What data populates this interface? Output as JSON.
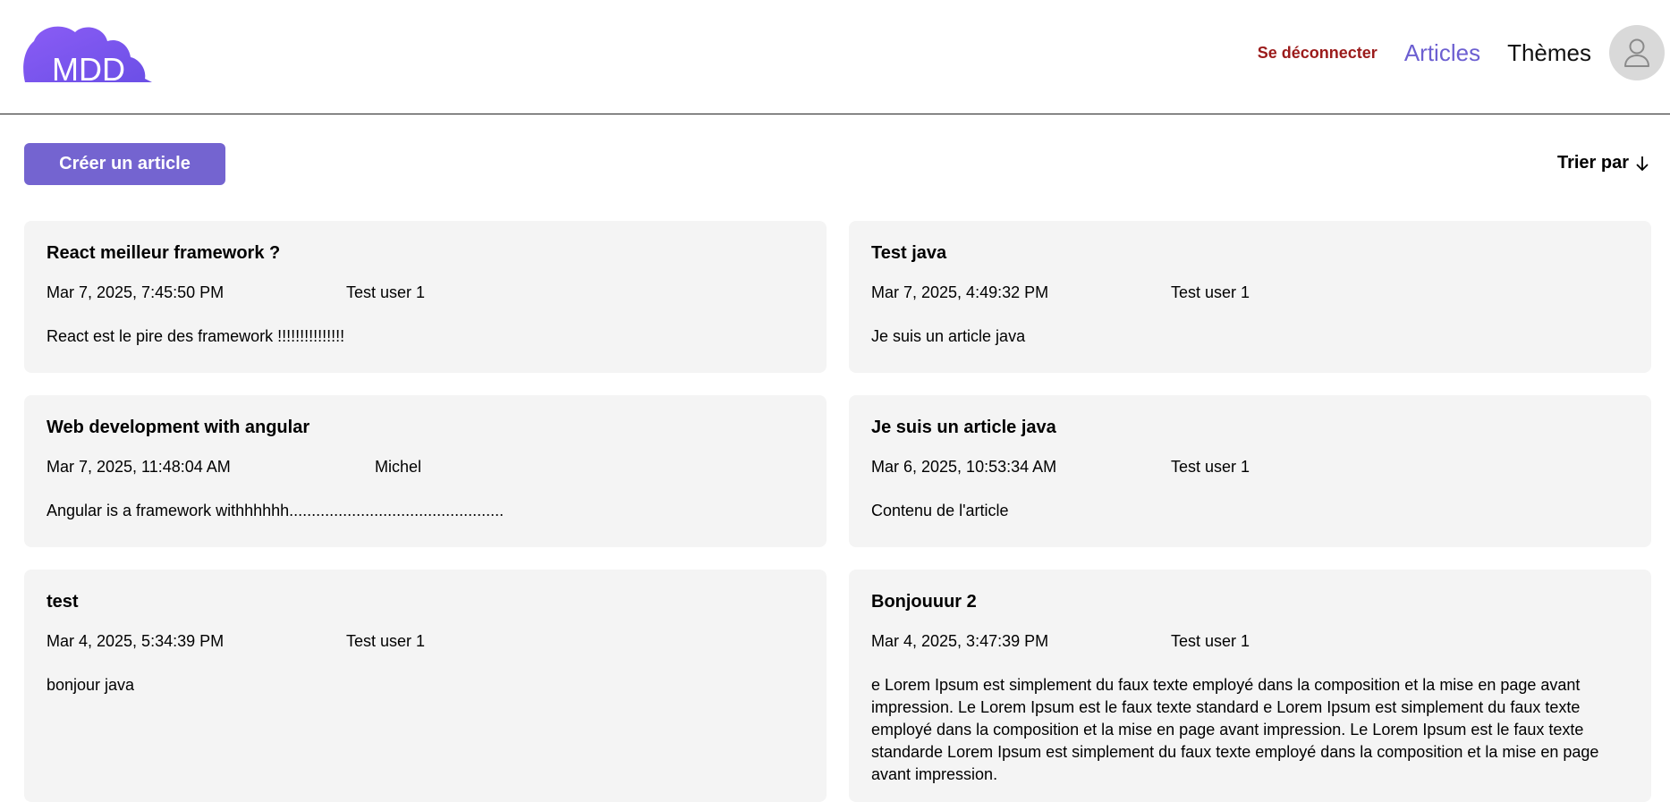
{
  "header": {
    "logo_text": "MDD",
    "logout_label": "Se déconnecter",
    "nav_articles": "Articles",
    "nav_themes": "Thèmes",
    "brand_color": "#7a5cf0"
  },
  "toolbar": {
    "create_label": "Créer un article",
    "sort_label": "Trier par"
  },
  "articles": [
    {
      "title": "React meilleur framework ?",
      "date": "Mar 7, 2025, 7:45:50 PM",
      "author": "Test user 1",
      "content": "React est le pire des framework !!!!!!!!!!!!!!!"
    },
    {
      "title": "Test java",
      "date": "Mar 7, 2025, 4:49:32 PM",
      "author": "Test user 1",
      "content": "Je suis un article java"
    },
    {
      "title": "Web development with angular",
      "date": "Mar 7, 2025, 11:48:04 AM",
      "author": "Michel",
      "content": "Angular is a framework withhhhhh................................................"
    },
    {
      "title": "Je suis un article java",
      "date": "Mar 6, 2025, 10:53:34 AM",
      "author": "Test user 1",
      "content": "Contenu de l'article"
    },
    {
      "title": "test",
      "date": "Mar 4, 2025, 5:34:39 PM",
      "author": "Test user 1",
      "content": "bonjour java"
    },
    {
      "title": "Bonjouuur 2",
      "date": "Mar 4, 2025, 3:47:39 PM",
      "author": "Test user 1",
      "content": "e Lorem Ipsum est simplement du faux texte employé dans la composition et la mise en page avant impression. Le Lorem Ipsum est le faux texte standard e Lorem Ipsum est simplement du faux texte employé dans la composition et la mise en page avant impression. Le Lorem Ipsum est le faux texte standarde Lorem Ipsum est simplement du faux texte employé dans la composition et la mise en page avant impression."
    }
  ]
}
